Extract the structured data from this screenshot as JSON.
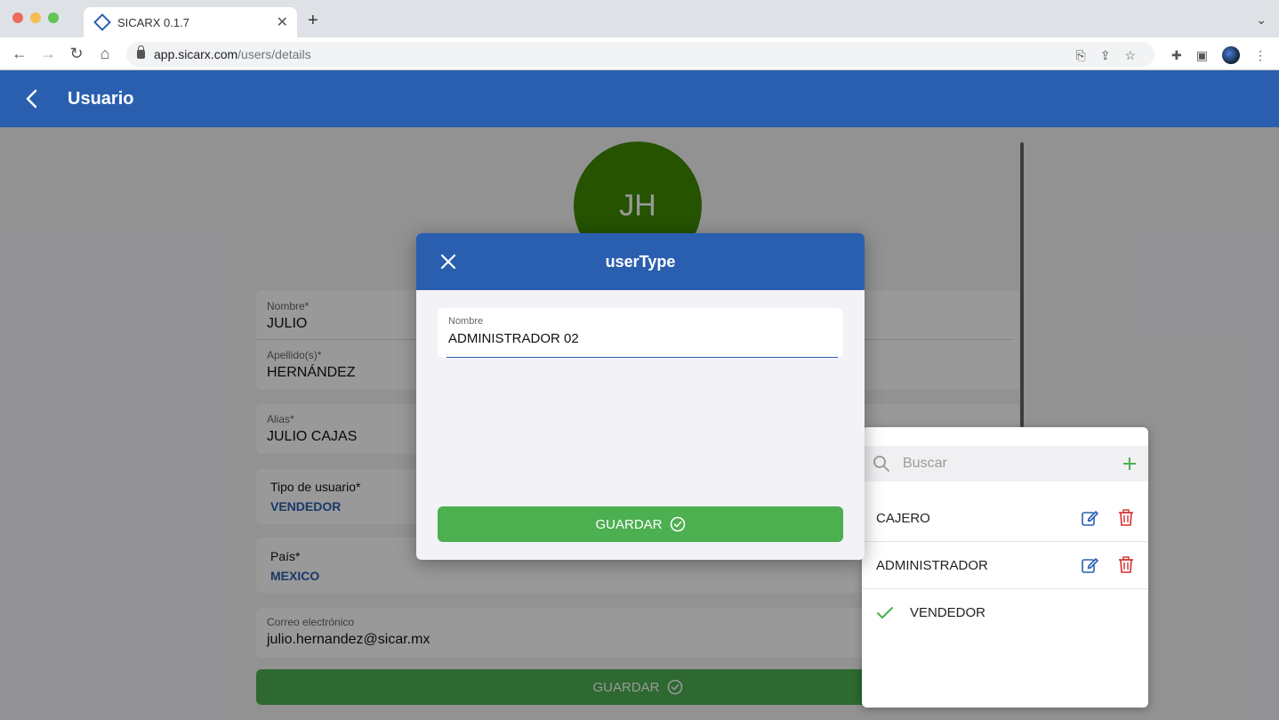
{
  "browser": {
    "tab_title": "SICARX 0.1.7",
    "url_host": "app.sicarx.com",
    "url_path": "/users/details",
    "new_tab_label": "+"
  },
  "header": {
    "title": "Usuario"
  },
  "avatar": {
    "initials": "JH"
  },
  "form": {
    "nombre_label": "Nombre*",
    "nombre_value": "JULIO",
    "apellido_label": "Apellido(s)*",
    "apellido_value": "HERNÁNDEZ",
    "alias_label": "Alias*",
    "alias_value": "JULIO CAJAS",
    "tipo_label": "Tipo de usuario*",
    "tipo_value": "VENDEDOR",
    "pais_label": "País*",
    "pais_value": "MEXICO",
    "correo_label": "Correo electrónico",
    "correo_value": "julio.hernandez@sicar.mx",
    "save_label": "GUARDAR"
  },
  "popover": {
    "search_placeholder": "Buscar",
    "items": [
      {
        "label": "CAJERO"
      },
      {
        "label": "ADMINISTRADOR"
      },
      {
        "label": "VENDEDOR"
      }
    ]
  },
  "modal": {
    "title": "userType",
    "field_label": "Nombre",
    "field_value": "ADMINISTRADOR 02",
    "save_label": "GUARDAR"
  },
  "colors": {
    "primary": "#2a5fb0",
    "success": "#4caf50",
    "danger": "#d32f2f",
    "avatar": "#3f8b00"
  },
  "icons": [
    "back-arrow-icon",
    "close-icon",
    "search-icon",
    "plus-icon",
    "edit-icon",
    "trash-icon",
    "check-icon",
    "check-circle-icon"
  ]
}
